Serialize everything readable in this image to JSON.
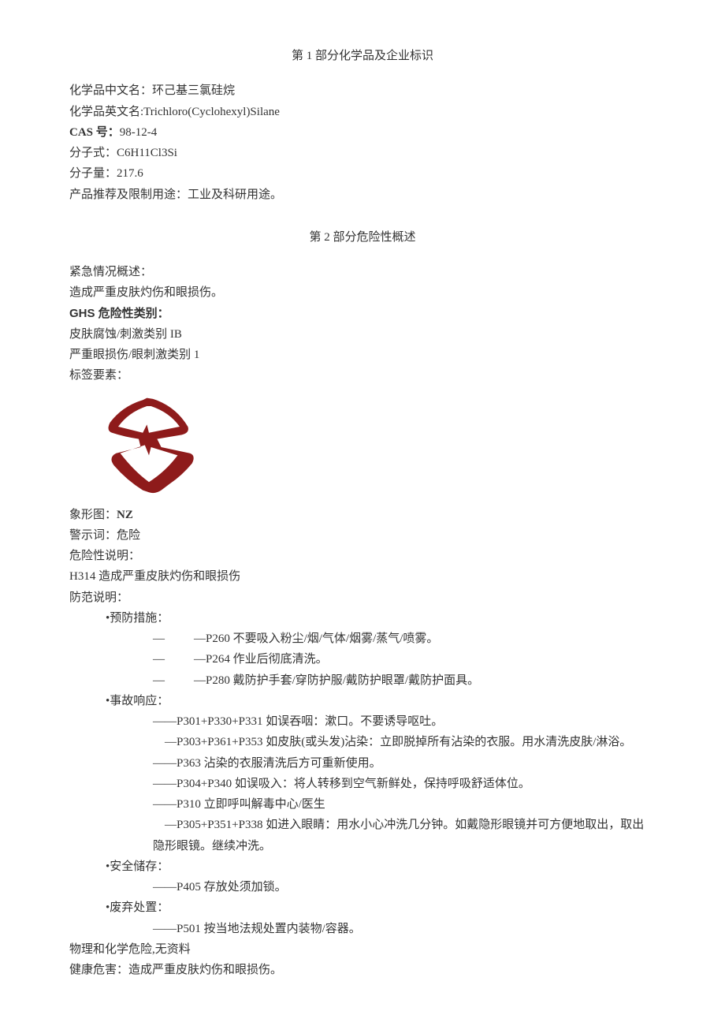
{
  "section1": {
    "title": "第 1 部分化学品及企业标识",
    "fields": {
      "chinese_name_label": "化学品中文名：",
      "chinese_name_value": "环己基三氯硅烷",
      "english_name_label": "化学品英文名:",
      "english_name_value": "Trichloro(Cyclohexyl)Silane",
      "cas_label": "CAS 号：",
      "cas_value": "98-12-4",
      "formula_label": "分子式：",
      "formula_value": "C6H11Cl3Si",
      "mw_label": "分子量：",
      "mw_value": "217.6",
      "use_label": "产品推荐及限制用途：",
      "use_value": "工业及科研用途。"
    }
  },
  "section2": {
    "title": "第 2 部分危险性概述",
    "emergency_label": "紧急情况概述：",
    "emergency_text": "造成严重皮肤灼伤和眼损伤。",
    "ghs_label": "GHS 危险性类别：",
    "ghs_items": [
      "皮肤腐蚀/刺激类别 IB",
      "严重眼损伤/眼刺激类别 1"
    ],
    "label_elements": "标签要素：",
    "pictogram_label": "象形图：",
    "pictogram_value": "NZ",
    "signal_label": "警示词：",
    "signal_value": "危险",
    "hazard_label": "危险性说明：",
    "hazard_statements": [
      "H314 造成严重皮肤灼伤和眼损伤"
    ],
    "precaution_label": "防范说明：",
    "precaution_groups": [
      {
        "header": "•预防措施：",
        "type": "dash",
        "items": [
          "—P260 不要吸入粉尘/烟/气体/烟雾/蒸气/喷雾。",
          "—P264 作业后彻底清洗。",
          "—P280 戴防护手套/穿防护服/戴防护眼罩/戴防护面具。"
        ]
      },
      {
        "header": "•事故响应：",
        "type": "plain",
        "items": [
          "——P301+P330+P331 如误吞咽：漱口。不要诱导呕吐。",
          "　—P303+P361+P353 如皮肤(或头发)沾染：立即脱掉所有沾染的衣服。用水清洗皮肤/淋浴。",
          "——P363 沾染的衣服清洗后方可重新使用。",
          "——P304+P340 如误吸入：将人转移到空气新鲜处，保持呼吸舒适体位。",
          "——P310 立即呼叫解毒中心/医生",
          "　—P305+P351+P338 如进入眼睛：用水小心冲洗几分钟。如戴隐形眼镜并可方便地取出，取出隐形眼镜。继续冲洗。"
        ]
      },
      {
        "header": "•安全储存：",
        "type": "plain",
        "items": [
          "——P405 存放处须加锁。"
        ]
      },
      {
        "header": "•废弃处置：",
        "type": "plain",
        "items": [
          "——P501 按当地法规处置内装物/容器。"
        ]
      }
    ],
    "phys_chem_line": "物理和化学危险,无资料",
    "health_label": "健康危害：",
    "health_value": "造成严重皮肤灼伤和眼损伤。"
  }
}
